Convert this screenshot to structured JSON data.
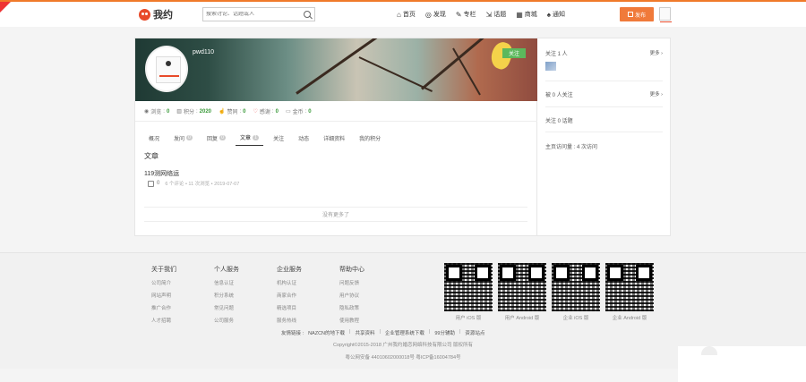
{
  "header": {
    "logo_text": "我约",
    "search_placeholder": "搜索讨论、话题或人",
    "nav": [
      {
        "icon": "home-icon",
        "glyph": "⌂",
        "label": "首页"
      },
      {
        "icon": "discover-icon",
        "glyph": "◎",
        "label": "发现"
      },
      {
        "icon": "column-icon",
        "glyph": "✎",
        "label": "专栏"
      },
      {
        "icon": "topic-icon",
        "glyph": "⇲",
        "label": "话题"
      },
      {
        "icon": "mall-icon",
        "glyph": "▦",
        "label": "商城"
      },
      {
        "icon": "notification-icon",
        "glyph": "♠",
        "label": "通知"
      }
    ],
    "publish_label": "发布"
  },
  "profile": {
    "username": "pwd110",
    "follow_label": "关注",
    "stats": [
      {
        "icon": "eye-icon",
        "label": "浏览",
        "value": "0"
      },
      {
        "icon": "chart-icon",
        "label": "积分",
        "value": "2020"
      },
      {
        "icon": "thumb-icon",
        "label": "赞同",
        "value": "0"
      },
      {
        "icon": "heart-icon",
        "label": "感谢",
        "value": "0"
      },
      {
        "icon": "wallet-icon",
        "label": "金币",
        "value": "0"
      }
    ],
    "tabs": [
      {
        "label": "概况",
        "badge": ""
      },
      {
        "label": "发问",
        "badge": "0"
      },
      {
        "label": "回复",
        "badge": "0"
      },
      {
        "label": "文章",
        "badge": "1",
        "active": true
      },
      {
        "label": "关注",
        "badge": ""
      },
      {
        "label": "动态",
        "badge": ""
      },
      {
        "label": "详细资料",
        "badge": ""
      },
      {
        "label": "我的积分",
        "badge": ""
      }
    ],
    "section_title": "文章",
    "article": {
      "title": "119测网络运",
      "likes": "0",
      "meta": "6 个评论 • 11 次浏览 • 2019-07-07"
    },
    "no_more": "没有更多了"
  },
  "sidebar": {
    "following_label": "关注 1 人",
    "more1": "更多 ›",
    "followers_label": "被 0 人关注",
    "more2": "更多 ›",
    "topics_label": "关注 0 话题",
    "views_label": "主页访问量 : 4 次访问"
  },
  "footer": {
    "columns": [
      {
        "title": "关于我们",
        "links": [
          "公司简介",
          "网站声明",
          "推广合作",
          "人才招聘"
        ]
      },
      {
        "title": "个人服务",
        "links": [
          "信息认证",
          "积分系统",
          "常见问题",
          "公司服务"
        ]
      },
      {
        "title": "企业服务",
        "links": [
          "机构认证",
          "商家合作",
          "精选项目",
          "服务热线"
        ]
      },
      {
        "title": "帮助中心",
        "links": [
          "问题反馈",
          "用户协议",
          "隐私政策",
          "使用教程"
        ]
      }
    ],
    "qrcodes": [
      "用户 iOS 版",
      "用户 Android 版",
      "企业 iOS 版",
      "企业 Android 版"
    ],
    "friend_links_label": "友情链接 :",
    "friend_links": [
      "NAZCN的地下载",
      "共享资料",
      "企业管理系统下载",
      "99分辅助",
      "资源站点"
    ],
    "copyright": "Copyright©2015-2018     广州我约婚恋网络科技有限公司 版权所有",
    "icp": "粤公网安备     44010602000018号     粤ICP备16004784号"
  }
}
